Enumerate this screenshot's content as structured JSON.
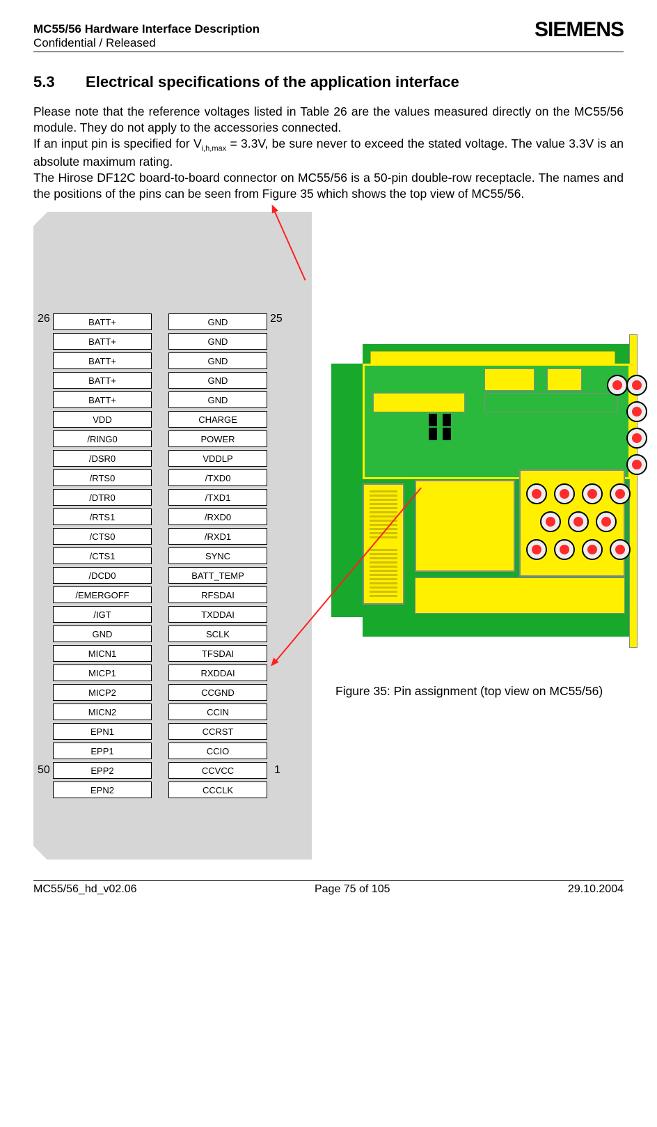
{
  "header": {
    "title": "MC55/56 Hardware Interface Description",
    "subtitle": "Confidential / Released",
    "logo": "SIEMENS"
  },
  "section": {
    "num": "5.3",
    "title": "Electrical specifications of the application interface"
  },
  "body_text": "Please note that the reference voltages listed in Table 26 are the values measured directly on the MC55/56 module. They do not apply to the accessories connected.\nIf an input pin is specified for Vi,h,max = 3.3V, be sure never to exceed the stated voltage. The value 3.3V is an absolute maximum rating.\nThe Hirose DF12C board-to-board connector on MC55/56 is a 50-pin double-row receptacle. The names and the positions of the pins can be seen from Figure 35 which shows the top view of MC55/56.",
  "pin_numbers": {
    "top_left": "26",
    "bottom_left": "50",
    "top_right": "25",
    "bottom_right": "1"
  },
  "pins_left": [
    "BATT+",
    "BATT+",
    "BATT+",
    "BATT+",
    "BATT+",
    "VDD",
    "/RING0",
    "/DSR0",
    "/RTS0",
    "/DTR0",
    "/RTS1",
    "/CTS0",
    "/CTS1",
    "/DCD0",
    "/EMERGOFF",
    "/IGT",
    "GND",
    "MICN1",
    "MICP1",
    "MICP2",
    "MICN2",
    "EPN1",
    "EPP1",
    "EPP2",
    "EPN2"
  ],
  "pins_right": [
    "GND",
    "GND",
    "GND",
    "GND",
    "GND",
    "CHARGE",
    "POWER",
    "VDDLP",
    "/TXD0",
    "/TXD1",
    "/RXD0",
    "/RXD1",
    "SYNC",
    "BATT_TEMP",
    "RFSDAI",
    "TXDDAI",
    "SCLK",
    "TFSDAI",
    "RXDDAI",
    "CCGND",
    "CCIN",
    "CCRST",
    "CCIO",
    "CCVCC",
    "CCCLK"
  ],
  "figure_caption": "Figure 35: Pin assignment (top view on MC55/56)",
  "footer": {
    "left": "MC55/56_hd_v02.06",
    "center": "Page 75 of 105",
    "right": "29.10.2004"
  }
}
